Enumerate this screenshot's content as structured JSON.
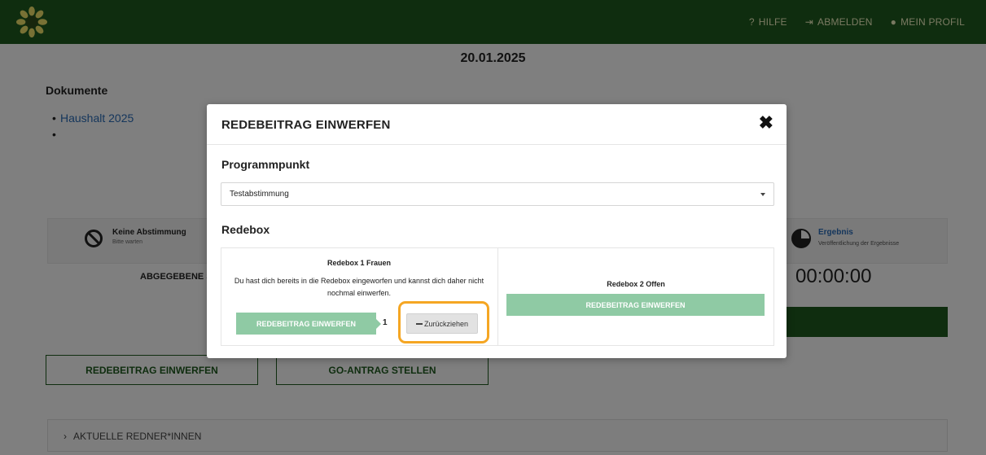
{
  "topbar": {
    "brand_color": "#1e5a1e",
    "logo_icon": "sunflower-logo",
    "nav": [
      {
        "icon": "question-icon",
        "glyph": "?",
        "label": "HILFE"
      },
      {
        "icon": "logout-icon",
        "glyph": "⇥",
        "label": "ABMELDEN"
      },
      {
        "icon": "user-icon",
        "glyph": "●",
        "label": "MEIN PROFIL"
      }
    ]
  },
  "page": {
    "date": "20.01.2025",
    "documents_title": "Dokumente",
    "documents": [
      {
        "label": "Haushalt 2025"
      },
      {
        "label": ""
      }
    ],
    "voting_status": {
      "label": "Keine Abstimmung",
      "sub": "Bitte warten"
    },
    "result": {
      "label": "Ergebnis",
      "sub": "Veröffentlichung der Ergebnisse"
    },
    "submitted_votes_label": "ABGEGEBENE ST",
    "timer": "00:00:00",
    "buttons": {
      "speech": "REDEBEITRAG EINWERFEN",
      "motion": "GO-ANTRAG STELLEN"
    },
    "accordion_label": "AKTUELLE REDNER*INNEN"
  },
  "modal": {
    "title": "REDEBEITRAG EINWERFEN",
    "close_glyph": "✖",
    "program_section": "Programmpunkt",
    "program_selected": "Testabstimmung",
    "redebox_section": "Redebox",
    "redebox1": {
      "title": "Redebox 1 Frauen",
      "message": "Du hast dich bereits in die Redebox eingeworfen und kannst dich daher nicht nochmal einwerfen.",
      "button": "REDEBEITRAG EINWERFEN",
      "count": "1",
      "withdraw": "Zurückziehen"
    },
    "redebox2": {
      "title": "Redebox 2 Offen",
      "button": "REDEBEITRAG EINWERFEN"
    },
    "accent_color": "#8fcaa4",
    "highlight_color": "#f5a623"
  }
}
